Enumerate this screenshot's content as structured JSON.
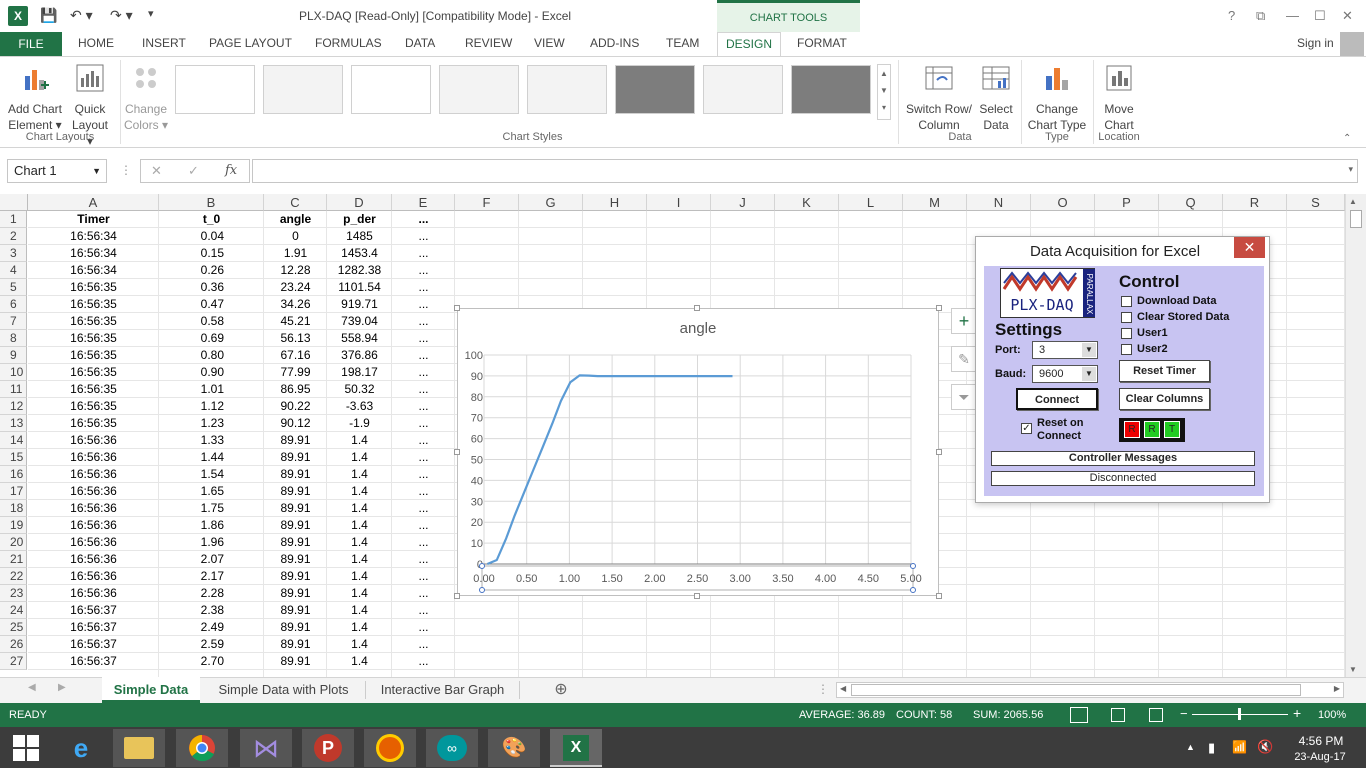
{
  "window": {
    "title": "PLX-DAQ  [Read-Only]  [Compatibility Mode] - Excel",
    "chart_tools": "CHART TOOLS",
    "help": "?",
    "minimize": "—",
    "maximize": "☐",
    "close": "✕"
  },
  "tabs": [
    "FILE",
    "HOME",
    "INSERT",
    "PAGE LAYOUT",
    "FORMULAS",
    "DATA",
    "REVIEW",
    "VIEW",
    "ADD-INS",
    "TEAM",
    "DESIGN",
    "FORMAT"
  ],
  "signin": "Sign in",
  "ribbon": {
    "add_chart_1": "Add Chart",
    "add_chart_2": "Element ▾",
    "quick_layout_1": "Quick",
    "quick_layout_2": "Layout ▾",
    "change_colors_1": "Change",
    "change_colors_2": "Colors ▾",
    "group_layouts": "Chart Layouts",
    "group_styles": "Chart Styles",
    "switch_1": "Switch Row/",
    "switch_2": "Column",
    "select_1": "Select",
    "select_2": "Data",
    "group_data": "Data",
    "change_type_1": "Change",
    "change_type_2": "Chart Type",
    "group_type": "Type",
    "move_1": "Move",
    "move_2": "Chart",
    "group_location": "Location"
  },
  "formula_bar": {
    "name_box": "Chart 1",
    "fx": "fx",
    "cancel": "✕",
    "enter": "✓"
  },
  "columns": [
    "A",
    "B",
    "C",
    "D",
    "E",
    "F",
    "G",
    "H",
    "I",
    "J",
    "K",
    "L",
    "M",
    "N",
    "O",
    "P",
    "Q",
    "R",
    "S"
  ],
  "headers": {
    "a": "Timer",
    "b": "t_0",
    "c": "angle",
    "d": "p_der",
    "e": "..."
  },
  "rows": [
    [
      "16:56:34",
      "0.04",
      "0",
      "1485"
    ],
    [
      "16:56:34",
      "0.15",
      "1.91",
      "1453.4"
    ],
    [
      "16:56:34",
      "0.26",
      "12.28",
      "1282.38"
    ],
    [
      "16:56:35",
      "0.36",
      "23.24",
      "1101.54"
    ],
    [
      "16:56:35",
      "0.47",
      "34.26",
      "919.71"
    ],
    [
      "16:56:35",
      "0.58",
      "45.21",
      "739.04"
    ],
    [
      "16:56:35",
      "0.69",
      "56.13",
      "558.94"
    ],
    [
      "16:56:35",
      "0.80",
      "67.16",
      "376.86"
    ],
    [
      "16:56:35",
      "0.90",
      "77.99",
      "198.17"
    ],
    [
      "16:56:35",
      "1.01",
      "86.95",
      "50.32"
    ],
    [
      "16:56:35",
      "1.12",
      "90.22",
      "-3.63"
    ],
    [
      "16:56:35",
      "1.23",
      "90.12",
      "-1.9"
    ],
    [
      "16:56:36",
      "1.33",
      "89.91",
      "1.4"
    ],
    [
      "16:56:36",
      "1.44",
      "89.91",
      "1.4"
    ],
    [
      "16:56:36",
      "1.54",
      "89.91",
      "1.4"
    ],
    [
      "16:56:36",
      "1.65",
      "89.91",
      "1.4"
    ],
    [
      "16:56:36",
      "1.75",
      "89.91",
      "1.4"
    ],
    [
      "16:56:36",
      "1.86",
      "89.91",
      "1.4"
    ],
    [
      "16:56:36",
      "1.96",
      "89.91",
      "1.4"
    ],
    [
      "16:56:36",
      "2.07",
      "89.91",
      "1.4"
    ],
    [
      "16:56:36",
      "2.17",
      "89.91",
      "1.4"
    ],
    [
      "16:56:36",
      "2.28",
      "89.91",
      "1.4"
    ],
    [
      "16:56:37",
      "2.38",
      "89.91",
      "1.4"
    ],
    [
      "16:56:37",
      "2.49",
      "89.91",
      "1.4"
    ],
    [
      "16:56:37",
      "2.59",
      "89.91",
      "1.4"
    ],
    [
      "16:56:37",
      "2.70",
      "89.91",
      "1.4"
    ]
  ],
  "row_numbers": [
    "1",
    "2",
    "3",
    "4",
    "5",
    "6",
    "7",
    "8",
    "9",
    "10",
    "11",
    "12",
    "13",
    "14",
    "15",
    "16",
    "17",
    "18",
    "19",
    "20",
    "21",
    "22",
    "23",
    "24",
    "25",
    "26",
    "27"
  ],
  "ellipsis": "...",
  "chart_data": {
    "type": "line",
    "title": "angle",
    "x_ticks": [
      "0.00",
      "0.50",
      "1.00",
      "1.50",
      "2.00",
      "2.50",
      "3.00",
      "3.50",
      "4.00",
      "4.50",
      "5.00"
    ],
    "y_ticks": [
      "0",
      "10",
      "20",
      "30",
      "40",
      "50",
      "60",
      "70",
      "80",
      "90",
      "100"
    ],
    "xlim": [
      0,
      5
    ],
    "ylim": [
      0,
      100
    ],
    "grid": true,
    "series": [
      {
        "color": "#5b9bd5",
        "x": [
          0.04,
          0.15,
          0.26,
          0.36,
          0.47,
          0.58,
          0.69,
          0.8,
          0.9,
          1.01,
          1.12,
          1.23,
          1.33,
          1.44,
          1.54,
          1.65,
          1.75,
          1.86,
          1.96,
          2.07,
          2.17,
          2.28,
          2.38,
          2.49,
          2.59,
          2.7,
          2.8,
          2.91
        ],
        "y": [
          0,
          1.91,
          12.28,
          23.24,
          34.26,
          45.21,
          56.13,
          67.16,
          77.99,
          86.95,
          90.22,
          90.12,
          89.91,
          89.91,
          89.91,
          89.91,
          89.91,
          89.91,
          89.91,
          89.91,
          89.91,
          89.91,
          89.91,
          89.91,
          89.91,
          89.91,
          89.91,
          89.91
        ]
      }
    ]
  },
  "plx": {
    "title": "Data Acquisition for Excel",
    "close": "✕",
    "logo": "PLX-DAQ",
    "logo_side": "PARALLAX",
    "settings": "Settings",
    "port_label": "Port:",
    "port_value": "3",
    "baud_label": "Baud:",
    "baud_value": "9600",
    "connect": "Connect",
    "reset_on_1": "Reset on",
    "reset_on_2": "Connect",
    "reset_check": "✓",
    "control": "Control",
    "download": "Download Data",
    "clear_stored": "Clear Stored Data",
    "user1": "User1",
    "user2": "User2",
    "reset_timer": "Reset Timer",
    "clear_columns": "Clear Columns",
    "ind_r1": "R",
    "ind_r2": "R",
    "ind_t": "T",
    "controller_messages": "Controller Messages",
    "status": "Disconnected"
  },
  "sheets": [
    "Simple Data",
    "Simple Data with Plots",
    "Interactive Bar Graph"
  ],
  "add_sheet": "⊕",
  "status": {
    "ready": "READY",
    "average": "AVERAGE: 36.89",
    "count": "COUNT: 58",
    "sum": "SUM: 2065.56",
    "zoom": "100%"
  },
  "taskbar": {
    "time": "4:56 PM",
    "date": "23-Aug-17"
  }
}
